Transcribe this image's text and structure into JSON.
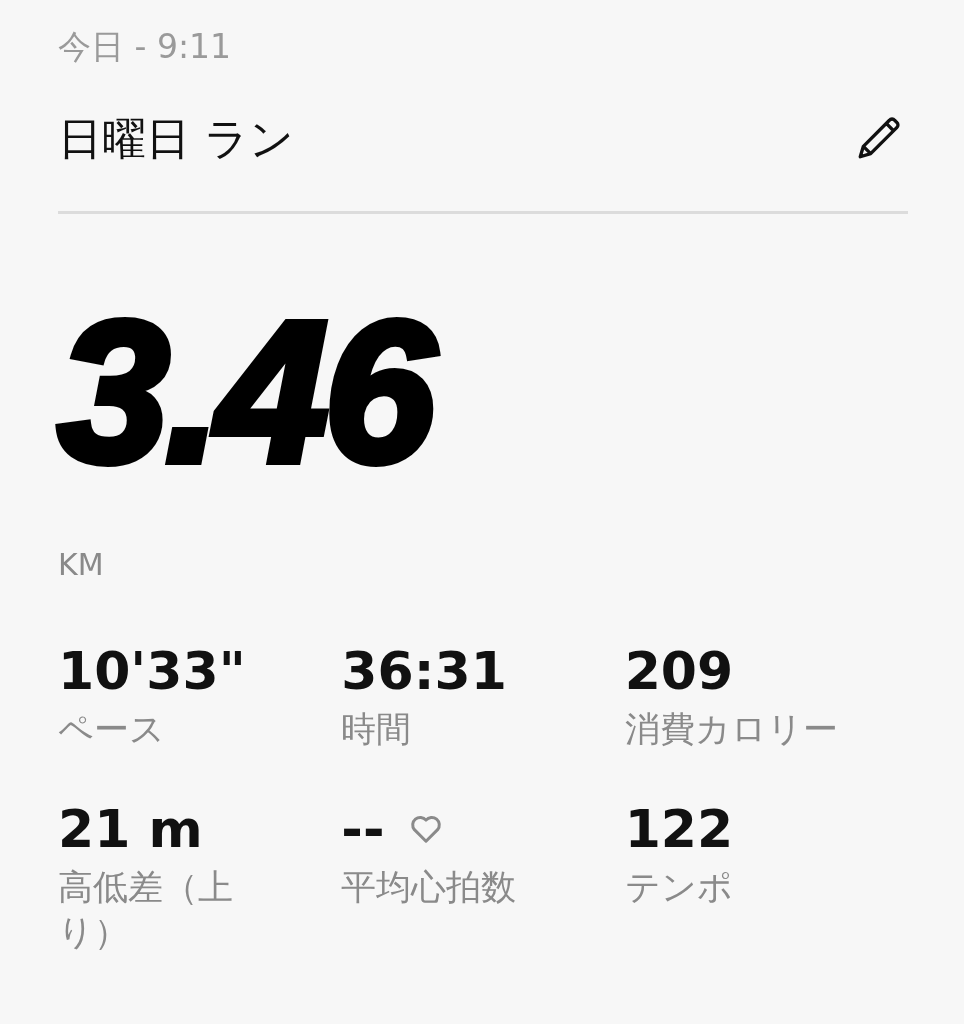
{
  "header": {
    "date": "今日 - 9:11",
    "title": "日曜日 ラン"
  },
  "distance": {
    "value": "3.46",
    "unit": "KM"
  },
  "stats": [
    {
      "kind": "value",
      "value": "10'33\"",
      "label": "ペース"
    },
    {
      "kind": "value",
      "value": "36:31",
      "label": "時間"
    },
    {
      "kind": "value",
      "value": "209",
      "label": "消費カロリー"
    },
    {
      "kind": "value",
      "value": "21 m",
      "label": "高低差（上り）"
    },
    {
      "kind": "heart_rate",
      "value": "--",
      "label": "平均心拍数"
    },
    {
      "kind": "value",
      "value": "122",
      "label": "テンポ"
    }
  ]
}
